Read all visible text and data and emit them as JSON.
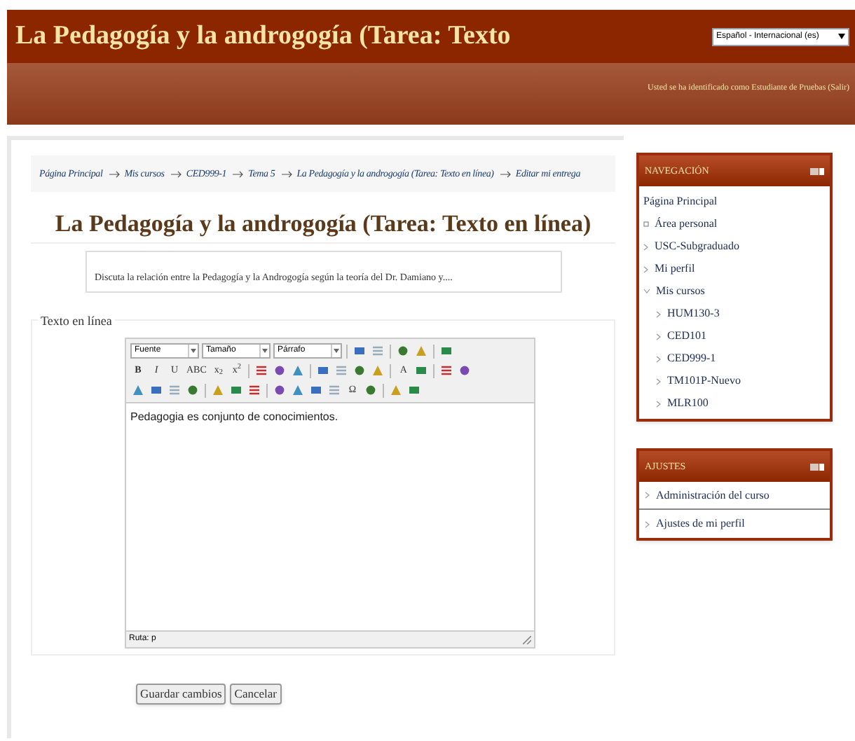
{
  "header": {
    "title": "La Pedagogía y la androgogía (Tarea: Texto",
    "language": "Español - Internacional (es)",
    "login_prefix": "Usted se ha identificado como",
    "login_user": "Estudiante de Pruebas",
    "login_logout": "(Salir)"
  },
  "breadcrumb": [
    "Página Principal",
    "Mis cursos",
    "CED999-1",
    "Tema 5",
    "La Pedagogía y la androgogía (Tarea: Texto en línea)",
    "Editar mi entrega"
  ],
  "heading": "La Pedagogía y la androgogía (Tarea: Texto en línea)",
  "intro": "Discuta la relación entre la Pedagogía y la Androgogía según la teoría del Dr. Damiano y....",
  "form": {
    "legend": "Texto en línea",
    "toolbar": [
      [
        {
          "kind": "select",
          "label": "Fuente"
        },
        {
          "kind": "select",
          "label": "Tamaño"
        },
        {
          "kind": "select",
          "label": "Párrafo"
        },
        {
          "kind": "sep"
        },
        {
          "kind": "icon"
        },
        {
          "kind": "icon"
        },
        {
          "kind": "sep"
        },
        {
          "kind": "icon"
        },
        {
          "kind": "icon"
        },
        {
          "kind": "sep"
        },
        {
          "kind": "icon"
        }
      ],
      [
        {
          "kind": "glyph",
          "text": "**B**"
        },
        {
          "kind": "glyph",
          "text": "*I*"
        },
        {
          "kind": "glyph",
          "text": "U"
        },
        {
          "kind": "glyph",
          "text": "ABC"
        },
        {
          "kind": "glyph",
          "text": "x$_{2}$"
        },
        {
          "kind": "glyph",
          "text": "x$^{2}$"
        },
        {
          "kind": "sep"
        },
        {
          "kind": "icon"
        },
        {
          "kind": "icon"
        },
        {
          "kind": "icon"
        },
        {
          "kind": "sep"
        },
        {
          "kind": "icon"
        },
        {
          "kind": "icon"
        },
        {
          "kind": "icon"
        },
        {
          "kind": "icon"
        },
        {
          "kind": "sep"
        },
        {
          "kind": "glyph",
          "text": "A"
        },
        {
          "kind": "icon"
        },
        {
          "kind": "sep"
        },
        {
          "kind": "icon"
        },
        {
          "kind": "icon"
        }
      ],
      [
        {
          "kind": "icon"
        },
        {
          "kind": "icon"
        },
        {
          "kind": "icon"
        },
        {
          "kind": "icon"
        },
        {
          "kind": "sep"
        },
        {
          "kind": "icon"
        },
        {
          "kind": "icon"
        },
        {
          "kind": "icon"
        },
        {
          "kind": "sep"
        },
        {
          "kind": "icon"
        },
        {
          "kind": "icon"
        },
        {
          "kind": "icon"
        },
        {
          "kind": "icon"
        },
        {
          "kind": "glyph",
          "text": "Ω"
        },
        {
          "kind": "icon"
        },
        {
          "kind": "sep"
        },
        {
          "kind": "icon"
        },
        {
          "kind": "icon"
        }
      ]
    ],
    "content": "Pedagogia es conjunto de conocimientos.",
    "path": "Ruta: p"
  },
  "buttons": [
    "Guardar cambios",
    "Cancelar"
  ],
  "navigation": {
    "title": "NAVEGACIÓN",
    "items": [
      {
        "label": "Página Principal",
        "kind": "root",
        "children": [
          {
            "label": "Área personal",
            "kind": "leaf"
          },
          {
            "label": "USC-Subgraduado",
            "kind": "branch",
            "expanded": false
          },
          {
            "label": "Mi perfil",
            "kind": "branch",
            "expanded": false
          },
          {
            "label": "Mis cursos",
            "kind": "branch",
            "expanded": true,
            "children": [
              {
                "label": "HUM130-3",
                "kind": "branch",
                "expanded": false
              },
              {
                "label": "CED101",
                "kind": "branch",
                "expanded": false
              },
              {
                "label": "CED999-1",
                "kind": "branch",
                "expanded": false
              },
              {
                "label": "TM101P-Nuevo",
                "kind": "branch",
                "expanded": false
              },
              {
                "label": "MLR100",
                "kind": "branch",
                "expanded": false
              }
            ]
          }
        ]
      }
    ]
  },
  "settings": {
    "title": "AJUSTES",
    "items": [
      {
        "label": "Administración del curso",
        "kind": "branch",
        "expanded": false
      },
      {
        "label": "Ajustes de mi perfil",
        "kind": "branch",
        "expanded": false
      }
    ]
  }
}
